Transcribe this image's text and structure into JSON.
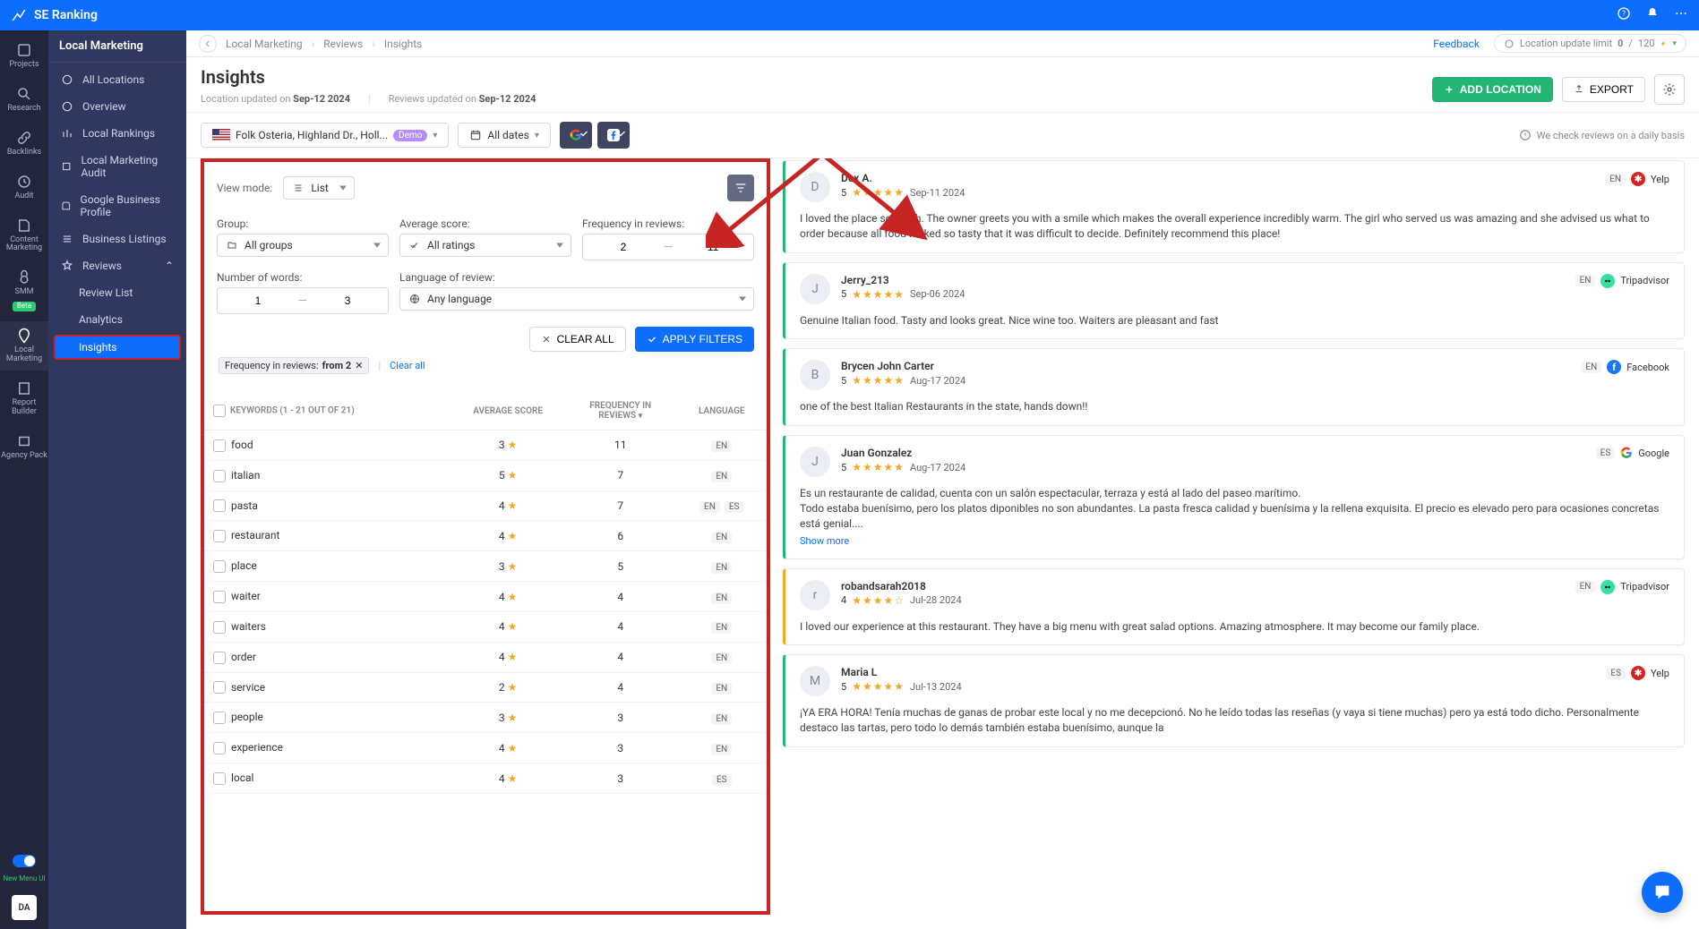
{
  "brand": "SE Ranking",
  "railnav": [
    {
      "label": "Projects"
    },
    {
      "label": "Research"
    },
    {
      "label": "Backlinks"
    },
    {
      "label": "Audit"
    },
    {
      "label": "Content Marketing"
    },
    {
      "label": "SMM",
      "beta": true
    },
    {
      "label": "Local Marketing",
      "active": true
    },
    {
      "label": "Report Builder"
    },
    {
      "label": "Agency Pack"
    }
  ],
  "railnav_newmenu": "New Menu UI",
  "railnav_avatar": "DA",
  "sidenav": {
    "title": "Local Marketing",
    "items": [
      {
        "label": "All Locations"
      },
      {
        "label": "Overview"
      },
      {
        "label": "Local Rankings"
      },
      {
        "label": "Local Marketing Audit"
      },
      {
        "label": "Google Business Profile"
      },
      {
        "label": "Business Listings"
      },
      {
        "label": "Reviews",
        "expanded": true,
        "children": [
          {
            "label": "Review List"
          },
          {
            "label": "Analytics"
          },
          {
            "label": "Insights",
            "active": true
          }
        ]
      }
    ]
  },
  "breadcrumbs": [
    "Local Marketing",
    "Reviews",
    "Insights"
  ],
  "feedback_label": "Feedback",
  "location_limit": {
    "prefix": "Location update limit",
    "used": "0",
    "sep": "/",
    "total": "120"
  },
  "page_title": "Insights",
  "meta": {
    "loc_label": "Location updated on",
    "loc_date": "Sep-12 2024",
    "rev_label": "Reviews updated on",
    "rev_date": "Sep-12 2024"
  },
  "actions": {
    "add_location": "ADD LOCATION",
    "export": "EXPORT"
  },
  "location_picker": "Folk Osteria, Highland Dr., Holl...",
  "demo": "Demo",
  "date_filter": "All dates",
  "daily_notice": "We check reviews on a daily basis",
  "viewmode_label": "View mode:",
  "viewmode_value": "List",
  "filters": {
    "group": {
      "label": "Group:",
      "value": "All groups"
    },
    "avg": {
      "label": "Average score:",
      "value": "All ratings"
    },
    "freq": {
      "label": "Frequency in reviews:",
      "from": "2",
      "to": "11"
    },
    "words": {
      "label": "Number of words:",
      "from": "1",
      "to": "3"
    },
    "lang": {
      "label": "Language of review:",
      "value": "Any language"
    }
  },
  "clear_all": "CLEAR ALL",
  "apply": "APPLY FILTERS",
  "chip": {
    "label": "Frequency in reviews:",
    "value": "from 2"
  },
  "clear_all_link": "Clear all",
  "table": {
    "headers": {
      "keywords": "KEYWORDS (1 - 21 OUT OF 21)",
      "avg": "AVERAGE SCORE",
      "freq": "FREQUENCY IN REVIEWS",
      "lang": "LANGUAGE"
    },
    "rows": [
      {
        "kw": "food",
        "avg": "3",
        "freq": "11",
        "lang": [
          "EN"
        ]
      },
      {
        "kw": "italian",
        "avg": "5",
        "freq": "7",
        "lang": [
          "EN"
        ]
      },
      {
        "kw": "pasta",
        "avg": "4",
        "freq": "7",
        "lang": [
          "EN",
          "ES"
        ]
      },
      {
        "kw": "restaurant",
        "avg": "4",
        "freq": "6",
        "lang": [
          "EN"
        ]
      },
      {
        "kw": "place",
        "avg": "3",
        "freq": "5",
        "lang": [
          "EN"
        ]
      },
      {
        "kw": "waiter",
        "avg": "4",
        "freq": "4",
        "lang": [
          "EN"
        ]
      },
      {
        "kw": "waiters",
        "avg": "4",
        "freq": "4",
        "lang": [
          "EN"
        ]
      },
      {
        "kw": "order",
        "avg": "4",
        "freq": "4",
        "lang": [
          "EN"
        ]
      },
      {
        "kw": "service",
        "avg": "2",
        "freq": "4",
        "lang": [
          "EN"
        ]
      },
      {
        "kw": "people",
        "avg": "3",
        "freq": "3",
        "lang": [
          "EN"
        ]
      },
      {
        "kw": "experience",
        "avg": "4",
        "freq": "3",
        "lang": [
          "EN"
        ]
      },
      {
        "kw": "local",
        "avg": "4",
        "freq": "3",
        "lang": [
          "ES"
        ]
      }
    ]
  },
  "reviews": [
    {
      "initial": "D",
      "name": "Dex A.",
      "score": "5",
      "date": "Sep-11 2024",
      "lang": "EN",
      "source": "Yelp",
      "color": "green",
      "body": "I loved the place so much. The owner greets you with a smile which makes the overall experience incredibly warm. The girl who served us was amazing and she advised us what to order because all food looked so tasty that it was difficult to decide. Definitely recommend this place!"
    },
    {
      "initial": "J",
      "name": "Jerry_213",
      "score": "5",
      "date": "Sep-06 2024",
      "lang": "EN",
      "source": "Tripadvisor",
      "color": "green",
      "body": "Genuine Italian food. Tasty and looks great. Nice wine too. Waiters are pleasant and fast"
    },
    {
      "initial": "B",
      "name": "Brycen John Carter",
      "score": "5",
      "date": "Aug-17 2024",
      "lang": "EN",
      "source": "Facebook",
      "color": "green",
      "body": "one of the best Italian Restaurants in the state, hands down!!"
    },
    {
      "initial": "J",
      "name": "Juan Gonzalez",
      "score": "5",
      "date": "Aug-17 2024",
      "lang": "ES",
      "source": "Google",
      "color": "green",
      "body": "Es un restaurante de calidad, cuenta con un salón espectacular, terraza y está al lado del paseo marítimo.\nTodo estaba buenísimo, pero los platos diponibles no son abundantes. La pasta fresca calidad y buenísima y la rellena exquisita. El precio es elevado pero para ocasiones concretas está genial....",
      "showmore": true
    },
    {
      "initial": "r",
      "name": "robandsarah2018",
      "score": "4",
      "date": "Jul-28 2024",
      "lang": "EN",
      "source": "Tripadvisor",
      "color": "yellow",
      "body": "I loved our experience at this restaurant. They have a big menu with great salad options. Amazing atmosphere. It may become our family place."
    },
    {
      "initial": "M",
      "name": "Maria L",
      "score": "5",
      "date": "Jul-13 2024",
      "lang": "ES",
      "source": "Yelp",
      "color": "green",
      "body": "¡YA ERA HORA! Tenía muchas de ganas de probar este local y no me decepcionó. No he leído todas las reseñas (y vaya si tiene muchas) pero ya está todo dicho. Personalmente destaco las tartas, pero todo lo demás también estaba buenísimo, aunque la"
    }
  ],
  "show_more": "Show more"
}
